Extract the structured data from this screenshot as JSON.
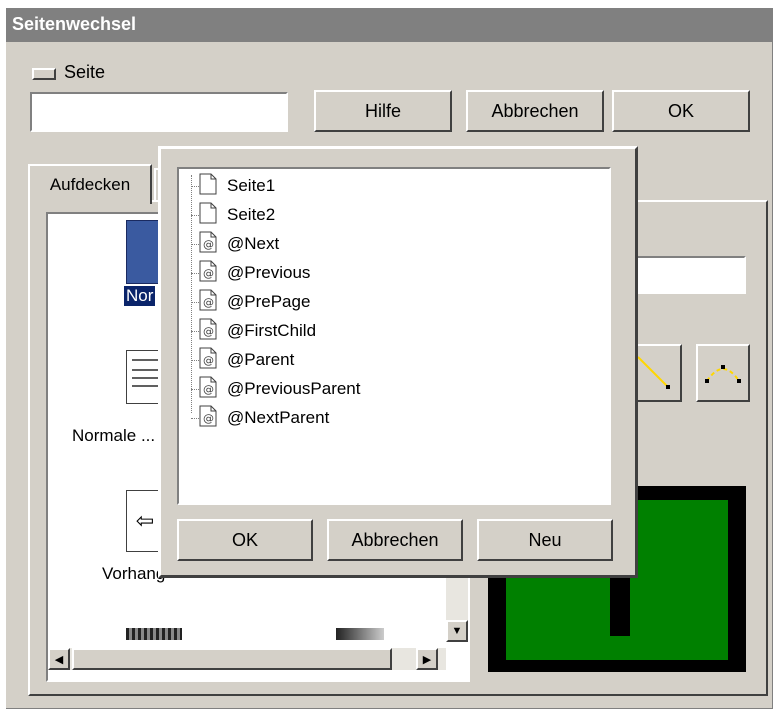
{
  "window": {
    "title": "Seitenwechsel"
  },
  "seite": {
    "label": "Seite",
    "value": ""
  },
  "buttons": {
    "hilfe": "Hilfe",
    "abbrechen": "Abbrechen",
    "ok": "OK"
  },
  "tabs": [
    {
      "label": "Aufdecken",
      "selected": true
    }
  ],
  "effects": {
    "selected_partial": "Nor",
    "item2_partial": "Normale ...",
    "item3_partial": "Vorhang"
  },
  "popup": {
    "items": [
      {
        "label": "Seite1",
        "icon": "page-icon"
      },
      {
        "label": "Seite2",
        "icon": "page-icon"
      },
      {
        "label": "@Next",
        "icon": "link-page-icon"
      },
      {
        "label": "@Previous",
        "icon": "link-page-icon"
      },
      {
        "label": "@PrePage",
        "icon": "link-page-icon"
      },
      {
        "label": "@FirstChild",
        "icon": "link-page-icon"
      },
      {
        "label": "@Parent",
        "icon": "link-page-icon"
      },
      {
        "label": "@PreviousParent",
        "icon": "link-page-icon"
      },
      {
        "label": "@NextParent",
        "icon": "link-page-icon"
      }
    ],
    "ok": "OK",
    "abbrechen": "Abbrechen",
    "neu": "Neu"
  },
  "colors": {
    "preview_fill": "#008000",
    "selection": "#0a246a",
    "face": "#d4d0c8"
  }
}
